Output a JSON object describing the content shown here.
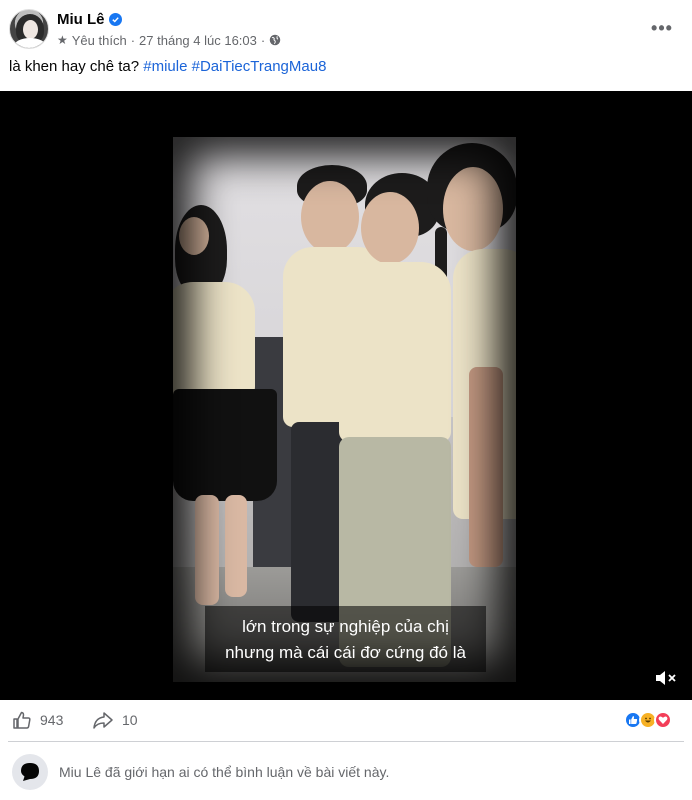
{
  "post": {
    "author": "Miu Lê",
    "audience": "Yêu thích",
    "timestamp": "27 tháng 4 lúc 16:03",
    "separator": "·",
    "caption_text": "là khen hay chê ta?",
    "hashtags": [
      "#miule",
      "#DaiTiecTrangMau8"
    ],
    "more_icon": "more-horizontal-icon"
  },
  "video": {
    "subtitle_line1": "lớn trong sự nghiệp của chị",
    "subtitle_line2": "nhưng mà cái cái đơ cứng đó là",
    "mute_icon": "volume-muted-icon"
  },
  "engagement": {
    "likes_count": "943",
    "shares_count": "10",
    "reaction_icons": [
      "like-reaction",
      "haha-reaction",
      "love-reaction"
    ]
  },
  "comment_box": {
    "restriction_text": "Miu Lê đã giới hạn ai có thể bình luận về bài viết này."
  },
  "colors": {
    "link": "#1b64d8",
    "verified": "#1877f2",
    "secondary_text": "#65676b"
  }
}
